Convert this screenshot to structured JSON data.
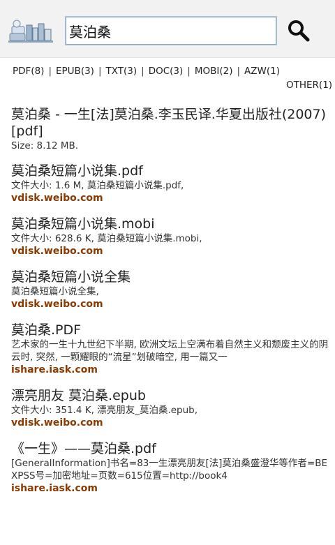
{
  "search": {
    "query": "莫泊桑"
  },
  "filters": {
    "row1": [
      {
        "label": "PDF(8)"
      },
      {
        "label": "EPUB(3)"
      },
      {
        "label": "TXT(3)"
      },
      {
        "label": "DOC(3)"
      },
      {
        "label": "MOBI(2)"
      },
      {
        "label": "AZW(1)"
      }
    ],
    "row2": [
      {
        "label": "OTHER(1)"
      }
    ],
    "separator": "|"
  },
  "results": [
    {
      "title": "莫泊桑 - 一生[法]莫泊桑.李玉民译.华夏出版社(2007) [pdf]",
      "desc": "Size: 8.12 MB.",
      "host": ""
    },
    {
      "title": "莫泊桑短篇小说集.pdf",
      "desc": "文件大小: 1.6 M, 莫泊桑短篇小说集.pdf,",
      "host": "vdisk.weibo.com"
    },
    {
      "title": "莫泊桑短篇小说集.mobi",
      "desc": "文件大小: 628.6 K, 莫泊桑短篇小说集.mobi,",
      "host": "vdisk.weibo.com"
    },
    {
      "title": "莫泊桑短篇小说全集",
      "desc": "莫泊桑短篇小说全集,",
      "host": "vdisk.weibo.com"
    },
    {
      "title": "莫泊桑.PDF",
      "desc": "艺术家的一生十九世纪下半期, 欧洲文坛上空满布着自然主义和颓废主义的阴云时, 突然, 一颗耀眼的“流星”划破暗空, 用一篇又一",
      "host": "ishare.iask.com"
    },
    {
      "title": "漂亮朋友 莫泊桑.epub",
      "desc": "文件大小: 351.4 K, 漂亮朋友_莫泊桑.epub,",
      "host": "vdisk.weibo.com"
    },
    {
      "title": "《一生》——莫泊桑.pdf",
      "desc": "[GeneralInformation]书名=83一生漂亮朋友[法]莫泊桑盛澄华等作者=BEXPSS号=加密地址=页数=615位置=http://book4",
      "host": "ishare.iask.com"
    }
  ],
  "colors": {
    "host": "#8a3a00",
    "topbar": "#f2f2f2"
  },
  "icons": {
    "logo": "books-logo-icon",
    "search": "search-icon"
  }
}
